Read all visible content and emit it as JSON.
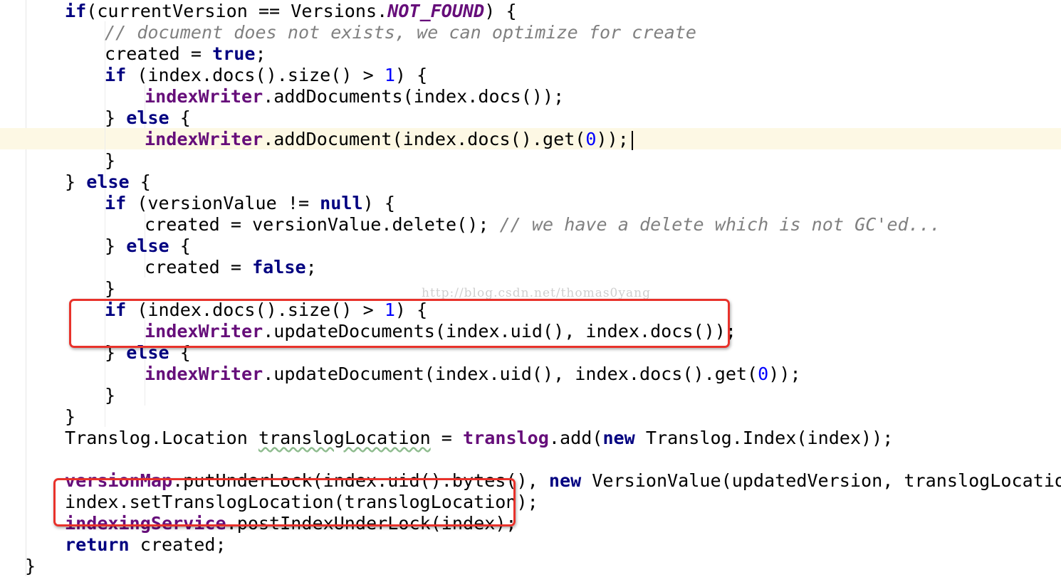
{
  "watermark": "http://blog.csdn.net/thomas0yang",
  "code": [
    {
      "indent": 1,
      "tokens": [
        [
          "kw",
          "if"
        ],
        [
          "",
          "(currentVersion == Versions."
        ],
        [
          "const",
          "NOT_FOUND"
        ],
        [
          "",
          ") {"
        ]
      ]
    },
    {
      "indent": 2,
      "tokens": [
        [
          "comment",
          "// document does not exists, we can optimize for create"
        ]
      ]
    },
    {
      "indent": 2,
      "tokens": [
        [
          "",
          "created = "
        ],
        [
          "kw",
          "true"
        ],
        [
          "",
          ";"
        ]
      ]
    },
    {
      "indent": 2,
      "tokens": [
        [
          "kw",
          "if"
        ],
        [
          "",
          " (index.docs().size() > "
        ],
        [
          "num",
          "1"
        ],
        [
          "",
          ") {"
        ]
      ]
    },
    {
      "indent": 3,
      "tokens": [
        [
          "field",
          "indexWriter"
        ],
        [
          "",
          ".addDocuments(index.docs());"
        ]
      ]
    },
    {
      "indent": 2,
      "tokens": [
        [
          "",
          "} "
        ],
        [
          "kw",
          "else"
        ],
        [
          "",
          " {"
        ]
      ]
    },
    {
      "indent": 3,
      "tokens": [
        [
          "field",
          "indexWriter"
        ],
        [
          "",
          ".addDocument(index.docs().get("
        ],
        [
          "num",
          "0"
        ],
        [
          "",
          "));"
        ]
      ],
      "caret": true
    },
    {
      "indent": 2,
      "tokens": [
        [
          "",
          "}"
        ]
      ]
    },
    {
      "indent": 1,
      "tokens": [
        [
          "",
          "} "
        ],
        [
          "kw",
          "else"
        ],
        [
          "",
          " {"
        ]
      ]
    },
    {
      "indent": 2,
      "tokens": [
        [
          "kw",
          "if"
        ],
        [
          "",
          " (versionValue != "
        ],
        [
          "kw",
          "null"
        ],
        [
          "",
          ") {"
        ]
      ]
    },
    {
      "indent": 3,
      "tokens": [
        [
          "",
          "created = versionValue.delete(); "
        ],
        [
          "comment",
          "// we have a delete which is not GC'ed..."
        ]
      ]
    },
    {
      "indent": 2,
      "tokens": [
        [
          "",
          "} "
        ],
        [
          "kw",
          "else"
        ],
        [
          "",
          " {"
        ]
      ]
    },
    {
      "indent": 3,
      "tokens": [
        [
          "",
          "created = "
        ],
        [
          "kw",
          "false"
        ],
        [
          "",
          ";"
        ]
      ]
    },
    {
      "indent": 2,
      "tokens": [
        [
          "",
          "}"
        ]
      ]
    },
    {
      "indent": 2,
      "tokens": [
        [
          "kw",
          "if"
        ],
        [
          "",
          " (index.docs().size() > "
        ],
        [
          "num",
          "1"
        ],
        [
          "",
          ") {"
        ]
      ]
    },
    {
      "indent": 3,
      "tokens": [
        [
          "field",
          "indexWriter"
        ],
        [
          "",
          ".updateDocuments(index.uid(), index.docs());"
        ]
      ]
    },
    {
      "indent": 2,
      "tokens": [
        [
          "",
          "} "
        ],
        [
          "kw",
          "else"
        ],
        [
          "",
          " {"
        ]
      ]
    },
    {
      "indent": 3,
      "tokens": [
        [
          "field",
          "indexWriter"
        ],
        [
          "",
          ".updateDocument(index.uid(), index.docs().get("
        ],
        [
          "num",
          "0"
        ],
        [
          "",
          "));"
        ]
      ]
    },
    {
      "indent": 2,
      "tokens": [
        [
          "",
          "}"
        ]
      ]
    },
    {
      "indent": 1,
      "tokens": [
        [
          "",
          "}"
        ]
      ]
    },
    {
      "indent": 1,
      "tokens": [
        [
          "",
          "Translog.Location "
        ],
        [
          "warn",
          "translogLocation"
        ],
        [
          "",
          " = "
        ],
        [
          "field",
          "translog"
        ],
        [
          "",
          ".add("
        ],
        [
          "kw",
          "new"
        ],
        [
          "",
          " Translog.Index(index));"
        ]
      ]
    },
    {
      "indent": 1,
      "tokens": []
    },
    {
      "indent": 1,
      "tokens": [
        [
          "field",
          "versionMap"
        ],
        [
          "",
          ".putUnderLock(index.uid().bytes(), "
        ],
        [
          "kw",
          "new"
        ],
        [
          "",
          " VersionValue(updatedVersion, translogLocation));"
        ]
      ]
    },
    {
      "indent": 1,
      "tokens": [
        [
          "",
          "index.setTranslogLocation(translogLocation);"
        ]
      ]
    },
    {
      "indent": 1,
      "tokens": [
        [
          "field",
          "indexingService"
        ],
        [
          "",
          ".postIndexUnderLock(index);"
        ]
      ]
    },
    {
      "indent": 1,
      "tokens": [
        [
          "kw",
          "return"
        ],
        [
          "",
          " created;"
        ]
      ]
    },
    {
      "indent": 0,
      "tokens": [
        [
          "",
          "}"
        ]
      ]
    }
  ]
}
